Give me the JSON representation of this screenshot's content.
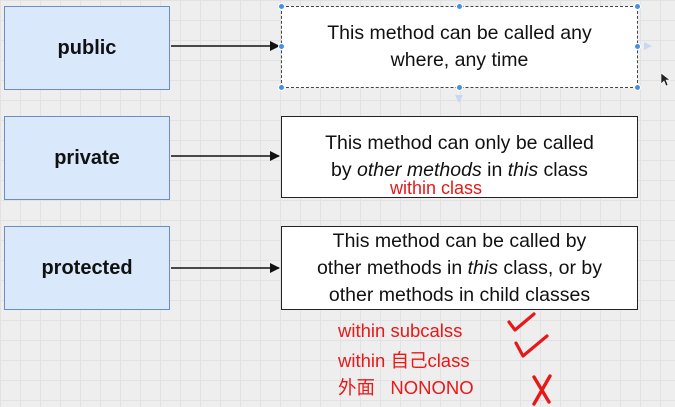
{
  "rows": [
    {
      "keyword": "public",
      "line1": "This method can be called any",
      "line2": "where, any time"
    },
    {
      "keyword": "private",
      "line1": "This method can only be called",
      "line2_parts": [
        "by ",
        "other methods",
        " in ",
        "this",
        " class"
      ]
    },
    {
      "keyword": "protected",
      "line1": "This method can be called by",
      "line2_parts": [
        "other methods in ",
        "this",
        " class, or by"
      ],
      "line3": "other methods in child classes"
    }
  ],
  "annotations": {
    "private_note": "within class",
    "protected_notes": [
      {
        "text": "within subcalss",
        "mark": "check"
      },
      {
        "text": "within 自己class",
        "mark": "check"
      },
      {
        "text": "外面   NONONO",
        "mark": "cross"
      }
    ]
  },
  "colors": {
    "box_fill": "#dae8fc",
    "box_stroke": "#6c8ebf",
    "annotation": "#e81818",
    "selection": "#4a90e2"
  }
}
